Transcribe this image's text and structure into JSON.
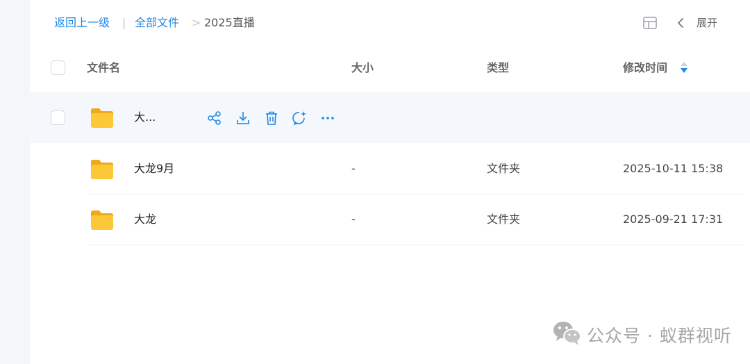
{
  "breadcrumb": {
    "back_label": "返回上一级",
    "separator": "|",
    "root_label": "全部文件",
    "arrow": ">",
    "current_label": "2025直播"
  },
  "toolbar": {
    "layout_icon": "grid-layout-icon",
    "collapse_icon": "chevron-left-icon",
    "expand_label": "展开"
  },
  "table": {
    "columns": {
      "name": "文件名",
      "size": "大小",
      "type": "类型",
      "modified": "修改时间"
    },
    "sort_icon": "sort-descending-icon",
    "rows": [
      {
        "name": "大...",
        "size": "",
        "type": "",
        "modified": "",
        "hovered": true,
        "actions": [
          "share-icon",
          "download-icon",
          "delete-icon",
          "comment-icon",
          "more-icon"
        ]
      },
      {
        "name": "大龙9月",
        "size": "-",
        "type": "文件夹",
        "modified": "2025-10-11 15:38"
      },
      {
        "name": "大龙",
        "size": "-",
        "type": "文件夹",
        "modified": "2025-09-21 17:31"
      }
    ]
  },
  "watermark": {
    "icon": "wechat-icon",
    "text": "公众号 · 蚁群视听"
  },
  "colors": {
    "accent": "#1e88e5",
    "folder": "#f9c02e",
    "row_hover": "#f4f7fb"
  }
}
